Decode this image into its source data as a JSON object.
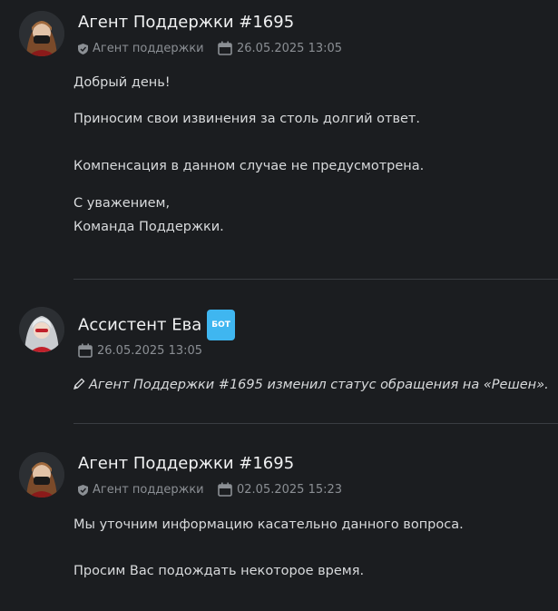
{
  "messages": [
    {
      "author": "Агент Поддержки #1695",
      "role": "Агент поддержки",
      "date": "26.05.2025 13:05",
      "lines": [
        "Добрый день!",
        "Приносим свои извинения за столь долгий ответ.",
        "Компенсация в данном случае не предусмотрена.",
        "С уважением,",
        "Команда Поддержки."
      ]
    },
    {
      "author": "Ассистент Ева",
      "badge": "БОТ",
      "date": "26.05.2025 13:05",
      "status": "Агент Поддержки #1695 изменил статус обращения на «Решен»."
    },
    {
      "author": "Агент Поддержки #1695",
      "role": "Агент поддержки",
      "date": "02.05.2025 15:23",
      "lines": [
        "Мы уточним информацию касательно данного вопроса.",
        "Просим Вас подождать некоторое время."
      ]
    }
  ],
  "colors": {
    "background": "#1b1d20",
    "bot_badge": "#3fb6f0",
    "divider": "#3a3d42"
  }
}
